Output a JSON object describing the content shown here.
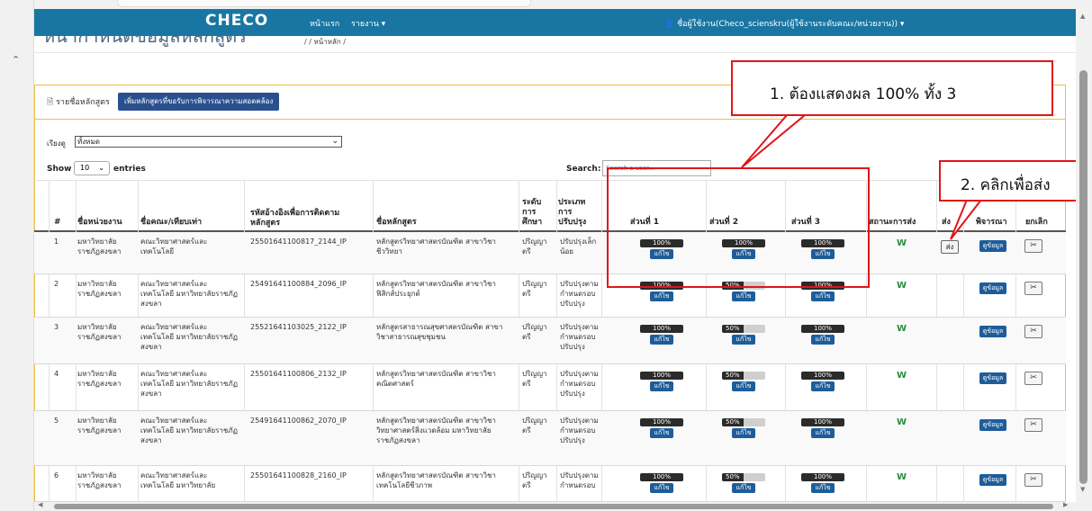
{
  "navbar": {
    "brand": "CHECO",
    "home": "หน้าแรก",
    "report": "รายงาน ▾",
    "user": "👤 ชื่อผู้ใช้งาน(Checo_scienskru(ผู้ใช้งานระดับคณะ/หน่วยงาน)) ▾"
  },
  "page": {
    "heading": "หน้ากำหนดข้อมูลหลักสูตร",
    "breadcrumb": "/    /  หน้าหลัก  /"
  },
  "panel": {
    "title": "🗎 รายชื่อหลักสูตร",
    "add_button": "เพิ่มหลักสูตรที่ขอรับการพิจารณาความสอดคล้อง"
  },
  "filter": {
    "label": "เรียงดู",
    "value": "ทั้งหมด"
  },
  "table_controls": {
    "show": "Show",
    "entries_value": "10",
    "entries": "entries",
    "search_label": "Search:",
    "search_placeholder": "Search a user..."
  },
  "columns": {
    "no": "#",
    "unit": "ชื่อหน่วยงาน",
    "faculty": "ชื่อคณะ/เทียบเท่า",
    "ref_code": "รหัสอ้างอิงเพื่อการติดตามหลักสูตร",
    "course": "ชื่อหลักสูตร",
    "level": "ระดับการศึกษา",
    "type": "ประเภทการปรับปรุง",
    "part1": "ส่วนที่ 1",
    "part2": "ส่วนที่ 2",
    "part3": "ส่วนที่ 3",
    "status": "สถานะการส่ง",
    "send": "ส่ง",
    "consider": "พิจารณา",
    "cancel": "ยกเลิก"
  },
  "buttons": {
    "edit": "แก้ไข",
    "send": "ส่ง",
    "data": "ดูข้อมูล",
    "cancel_icon": "✂"
  },
  "rows": [
    {
      "no": "1",
      "unit": "มหาวิทยาลัยราชภัฏสงขลา",
      "faculty": "คณะวิทยาศาสตร์และเทคโนโลยี",
      "ref": "25501641100817_2144_IP",
      "course": "หลักสูตรวิทยาศาสตรบัณฑิต สาขาวิชาชีววิทยา",
      "level": "ปริญญาตรี",
      "type": "ปรับปรุงเล็กน้อย",
      "p1": "100%",
      "p2": "100%",
      "p3": "100%",
      "p1v": 100,
      "p2v": 100,
      "p3v": 100,
      "status": "W",
      "send": true
    },
    {
      "no": "2",
      "unit": "มหาวิทยาลัยราชภัฏสงขลา",
      "faculty": "คณะวิทยาศาสตร์และเทคโนโลยี มหาวิทยาลัยราชภัฏสงขลา",
      "ref": "25491641100884_2096_IP",
      "course": "หลักสูตรวิทยาศาสตรบัณฑิต สาขาวิชาฟิสิกส์ประยุกต์",
      "level": "ปริญญาตรี",
      "type": "ปรับปรุงตามกำหนดรอบปรับปรุง",
      "p1": "100%",
      "p2": "50%",
      "p3": "100%",
      "p1v": 100,
      "p2v": 50,
      "p3v": 100,
      "status": "W",
      "send": false
    },
    {
      "no": "3",
      "unit": "มหาวิทยาลัยราชภัฏสงขลา",
      "faculty": "คณะวิทยาศาสตร์และเทคโนโลยี มหาวิทยาลัยราชภัฏสงขลา",
      "ref": "25521641103025_2122_IP",
      "course": "หลักสูตรสาธารณสุขศาสตรบัณฑิต สาขาวิชาสาธารณสุขชุมชน",
      "level": "ปริญญาตรี",
      "type": "ปรับปรุงตามกำหนดรอบปรับปรุง",
      "p1": "100%",
      "p2": "50%",
      "p3": "100%",
      "p1v": 100,
      "p2v": 50,
      "p3v": 100,
      "status": "W",
      "send": false
    },
    {
      "no": "4",
      "unit": "มหาวิทยาลัยราชภัฏสงขลา",
      "faculty": "คณะวิทยาศาสตร์และเทคโนโลยี มหาวิทยาลัยราชภัฏสงขลา",
      "ref": "25501641100806_2132_IP",
      "course": "หลักสูตรวิทยาศาสตรบัณฑิต สาขาวิชาคณิตศาสตร์",
      "level": "ปริญญาตรี",
      "type": "ปรับปรุงตามกำหนดรอบปรับปรุง",
      "p1": "100%",
      "p2": "50%",
      "p3": "100%",
      "p1v": 100,
      "p2v": 50,
      "p3v": 100,
      "status": "W",
      "send": false
    },
    {
      "no": "5",
      "unit": "มหาวิทยาลัยราชภัฏสงขลา",
      "faculty": "คณะวิทยาศาสตร์และเทคโนโลยี มหาวิทยาลัยราชภัฏสงขลา",
      "ref": "25491641100862_2070_IP",
      "course": "หลักสูตรวิทยาศาสตรบัณฑิต สาขาวิชาวิทยาศาสตร์สิ่งแวดล้อม มหาวิทยาลัยราชภัฏสงขลา",
      "level": "ปริญญาตรี",
      "type": "ปรับปรุงตามกำหนดรอบปรับปรุง",
      "p1": "100%",
      "p2": "50%",
      "p3": "100%",
      "p1v": 100,
      "p2v": 50,
      "p3v": 100,
      "status": "W",
      "send": false
    },
    {
      "no": "6",
      "unit": "มหาวิทยาลัยราชภัฏสงขลา",
      "faculty": "คณะวิทยาศาสตร์และเทคโนโลยี มหาวิทยาลัย",
      "ref": "25501641100828_2160_IP",
      "course": "หลักสูตรวิทยาศาสตรบัณฑิต สาขาวิชาเทคโนโลยีชีวภาพ",
      "level": "ปริญญาตรี",
      "type": "ปรับปรุงตามกำหนดรอบ",
      "p1": "100%",
      "p2": "50%",
      "p3": "100%",
      "p1v": 100,
      "p2v": 50,
      "p3v": 100,
      "status": "W",
      "send": false
    }
  ],
  "annotations": {
    "callout1": "1. ต้องแสดงผล 100% ทั้ง 3",
    "callout2": "2. คลิกเพื่อส่ง",
    "color": "#e0151a"
  },
  "colors": {
    "navbar": "#1976a3",
    "primary_button": "#1e5d9a",
    "status_w": "#2e8b3b",
    "panel_border": "#f0c040"
  }
}
